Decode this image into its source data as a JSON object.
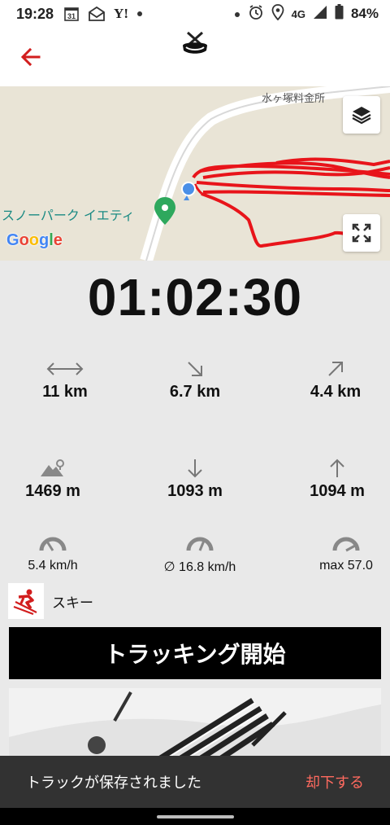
{
  "status_bar": {
    "time": "19:28",
    "calendar_day": "31",
    "yahoo": "Y!",
    "network": "4G",
    "battery": "84%"
  },
  "colors": {
    "accent": "#d21e1e",
    "track": "#e8141a",
    "snackbar_bg": "#323232",
    "snackbar_action": "#ff6a5f"
  },
  "map": {
    "road_label": "水ヶ塚料金所",
    "park_label": "スノーパーク イエティ",
    "google": [
      "G",
      "o",
      "o",
      "g",
      "l",
      "e"
    ]
  },
  "timer": "01:02:30",
  "stats": [
    {
      "icon": "distance-arrow-icon",
      "value": "11 km"
    },
    {
      "icon": "descent-arrow-icon",
      "value": "6.7 km"
    },
    {
      "icon": "ascent-arrow-icon",
      "value": "4.4 km"
    },
    {
      "icon": "altitude-mountain-icon",
      "value": "1469 m"
    },
    {
      "icon": "down-arrow-icon",
      "value": "1093 m"
    },
    {
      "icon": "up-arrow-icon",
      "value": "1094 m"
    },
    {
      "icon": "speedometer-icon",
      "value": "5.4 km/h"
    },
    {
      "icon": "speedometer-icon",
      "value": "∅ 16.8 km/h"
    },
    {
      "icon": "speedometer-icon",
      "value": "max 57.0"
    }
  ],
  "activity": {
    "icon": "skier-icon",
    "label": "スキー"
  },
  "track_button": "トラッキング開始",
  "snackbar": {
    "message": "トラックが保存されました",
    "action": "却下する"
  }
}
